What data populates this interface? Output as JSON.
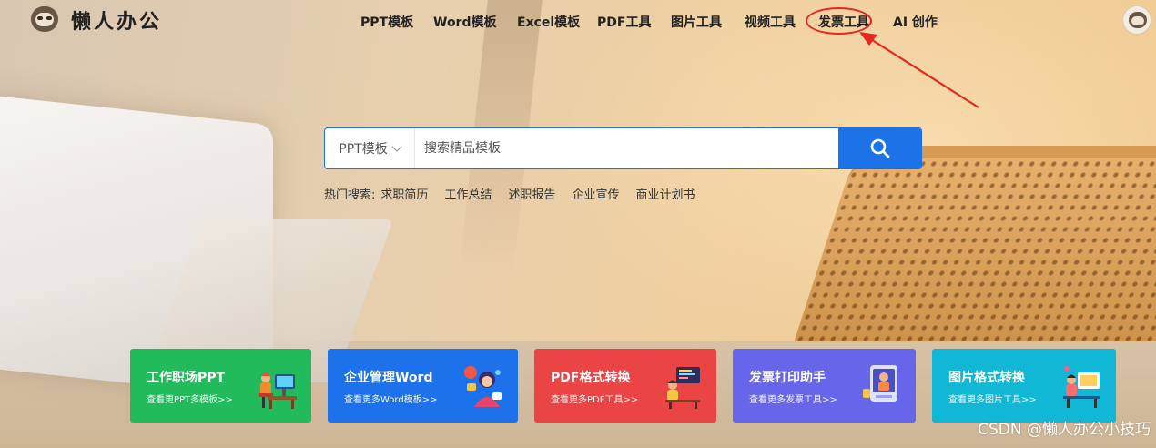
{
  "brand": {
    "name": "懒人办公"
  },
  "nav": {
    "items": [
      {
        "label": "PPT模板"
      },
      {
        "label": "Word模板"
      },
      {
        "label": "Excel模板"
      },
      {
        "label": "PDF工具"
      },
      {
        "label": "图片工具"
      },
      {
        "label": "视频工具"
      },
      {
        "label": "发票工具"
      },
      {
        "label": "AI 创作"
      }
    ],
    "highlighted": "发票工具"
  },
  "search": {
    "category": "PPT模板",
    "placeholder": "搜索精品模板",
    "button_icon": "search-icon"
  },
  "hot_searches": {
    "label": "热门搜索:",
    "items": [
      "求职简历",
      "工作总结",
      "述职报告",
      "企业宣传",
      "商业计划书"
    ]
  },
  "cards": [
    {
      "title": "工作职场PPT",
      "subtitle": "查看更PPT多模板>>",
      "color": "#22bb5c",
      "icon": "office-worker-icon"
    },
    {
      "title": "企业管理Word",
      "subtitle": "查看更多Word模板>>",
      "color": "#1d72eb",
      "icon": "business-woman-icon"
    },
    {
      "title": "PDF格式转换",
      "subtitle": "查看更多PDF工具>>",
      "color": "#eb4445",
      "icon": "pdf-convert-icon"
    },
    {
      "title": "发票打印助手",
      "subtitle": "查看更多发票工具>>",
      "color": "#6766ea",
      "icon": "invoice-print-icon"
    },
    {
      "title": "图片格式转换",
      "subtitle": "查看更多图片工具>>",
      "color": "#10b8d6",
      "icon": "image-convert-icon"
    }
  ],
  "annotation": {
    "color": "#e8261e"
  },
  "watermark": "CSDN @懒人办公小技巧"
}
